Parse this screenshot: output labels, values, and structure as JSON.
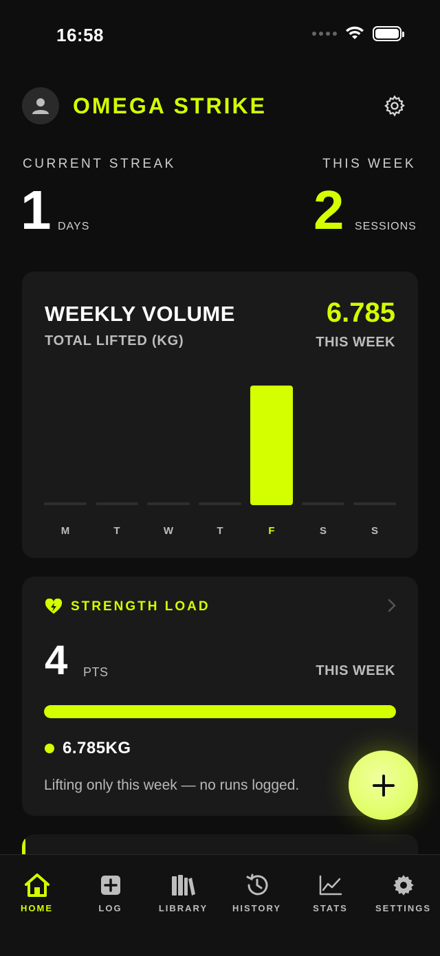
{
  "status_bar": {
    "time": "16:58"
  },
  "header": {
    "title": "OMEGA STRIKE"
  },
  "stats": {
    "streak_label": "CURRENT STREAK",
    "streak_value": "1",
    "streak_unit": "DAYS",
    "week_label": "THIS WEEK",
    "week_value": "2",
    "week_unit": "SESSIONS"
  },
  "volume_card": {
    "title": "WEEKLY VOLUME",
    "subtitle": "TOTAL LIFTED (KG)",
    "value": "6.785",
    "value_label": "THIS WEEK"
  },
  "chart_data": {
    "type": "bar",
    "categories": [
      "M",
      "T",
      "W",
      "T",
      "F",
      "S",
      "S"
    ],
    "values": [
      0,
      0,
      0,
      0,
      6.785,
      0,
      0
    ],
    "highlight_index": 4,
    "ylim": [
      0,
      6.785
    ],
    "colors": {
      "bar": "#d4ff00",
      "empty": "#2e2e2e",
      "label": "#bdbdbd",
      "label_active": "#d4ff00"
    }
  },
  "load_card": {
    "title": "STRENGTH LOAD",
    "value": "4",
    "unit": "PTS",
    "week_label": "THIS WEEK",
    "progress": 1.0,
    "legend_value": "6.785KG",
    "note": "Lifting only this week — no runs logged."
  },
  "tab_bar": {
    "tabs": [
      {
        "label": "HOME",
        "icon": "home-icon",
        "active": true
      },
      {
        "label": "LOG",
        "icon": "plus-square-icon",
        "active": false
      },
      {
        "label": "LIBRARY",
        "icon": "library-icon",
        "active": false
      },
      {
        "label": "HISTORY",
        "icon": "history-icon",
        "active": false
      },
      {
        "label": "STATS",
        "icon": "chart-line-icon",
        "active": false
      },
      {
        "label": "SETTINGS",
        "icon": "gear-icon",
        "active": false
      }
    ]
  },
  "colors": {
    "accent": "#d4ff00",
    "background": "#0e0e0e",
    "card": "#1a1a1a"
  }
}
